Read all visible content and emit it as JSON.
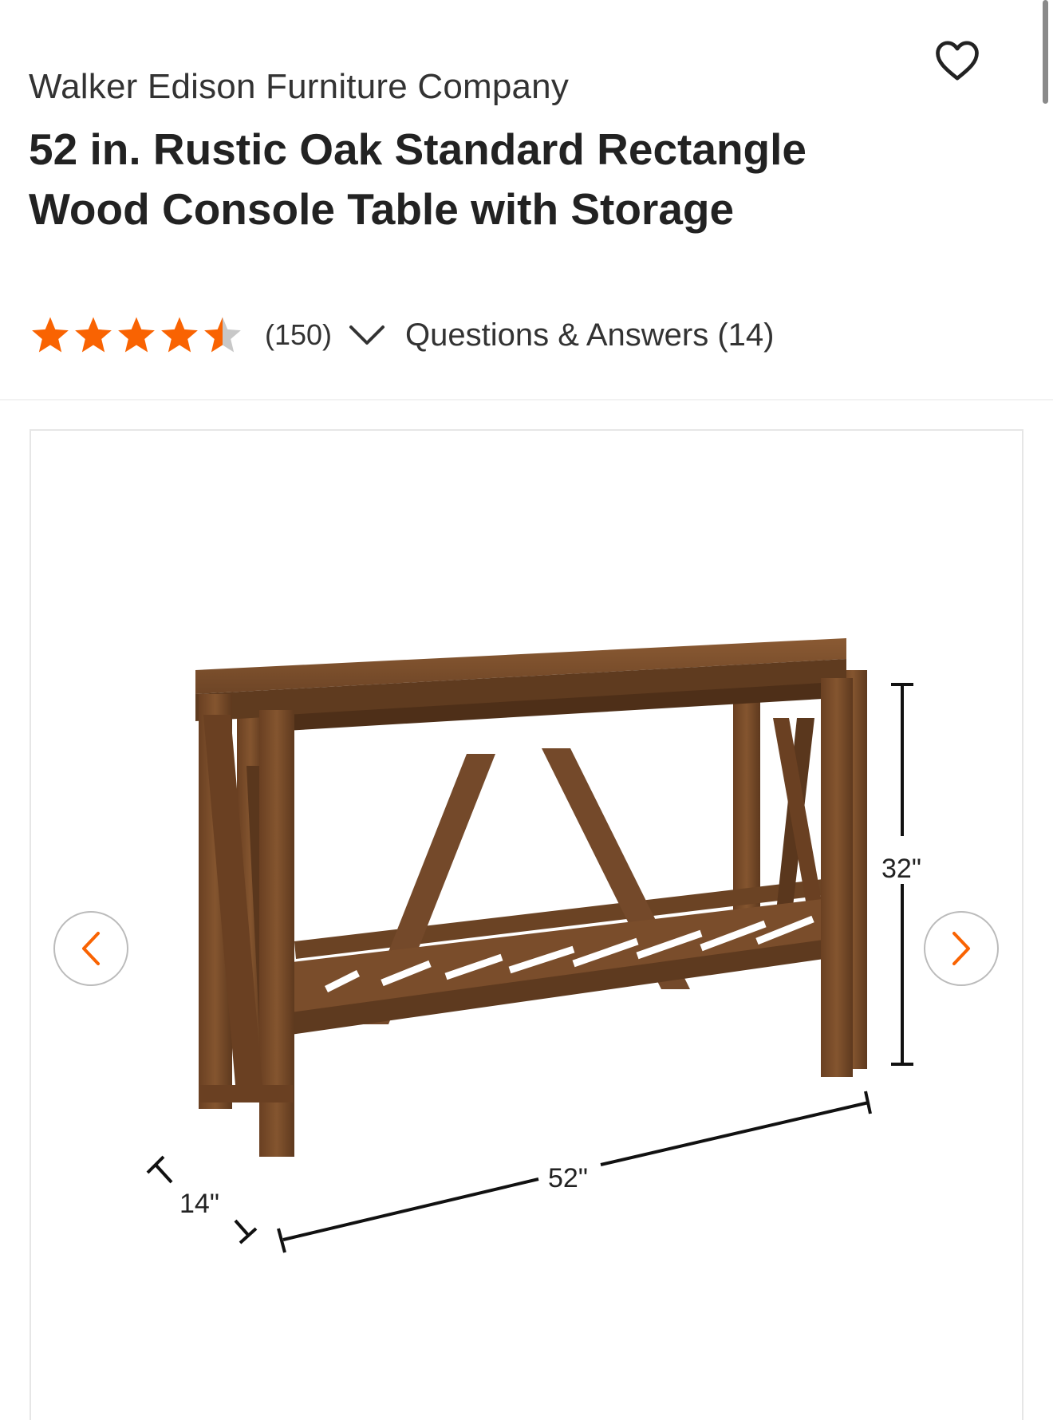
{
  "product": {
    "brand": "Walker Edison Furniture Company",
    "title": "52 in. Rustic Oak Standard Rectangle Wood Console Table with Storage",
    "rating": 4.5,
    "rating_max": 5,
    "review_count": "(150)",
    "qa_label": "Questions & Answers (14)"
  },
  "image": {
    "alt": "52 in. Rustic Oak Standard Rectangle Wood Console Table with Storage",
    "dimensions": {
      "height": "32\"",
      "width": "52\"",
      "depth": "14\""
    }
  },
  "icons": {
    "favorite": "heart-outline-icon",
    "expand_reviews": "chevron-down-icon",
    "prev": "chevron-left-icon",
    "next": "chevron-right-icon"
  },
  "colors": {
    "accent": "#f96302",
    "star_empty": "#c8c8c8",
    "text": "#222222",
    "wood": "#7b4f2c"
  }
}
